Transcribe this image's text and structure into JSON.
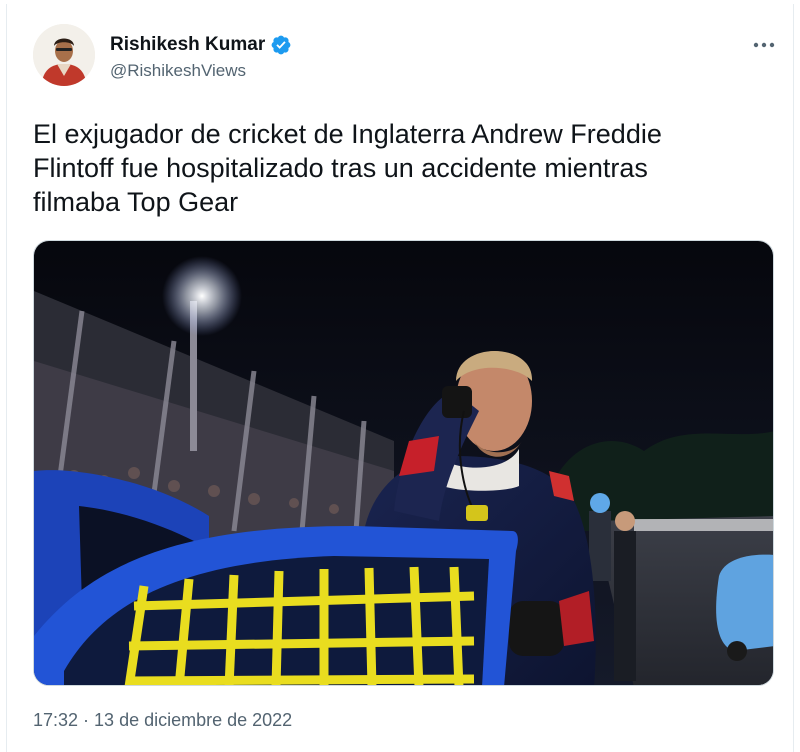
{
  "tweet": {
    "author": {
      "display_name": "Rishikesh Kumar",
      "handle": "@RishikeshViews",
      "verified": true,
      "avatar_icon": "person-photo"
    },
    "more_icon": "more-horizontal-icon",
    "text": "El exjugador de cricket de Inglaterra Andrew Freddie\nFlintoff fue hospitalizado tras un accidente mientras\nfilmaba Top Gear",
    "media": {
      "type": "photo",
      "icon": "photo-race-driver"
    },
    "timestamp": "17:32 · 13 de diciembre de 2022"
  },
  "colors": {
    "text_primary": "#0f1419",
    "text_secondary": "#536471",
    "verified_blue": "#1d9bf0",
    "border": "#cfd9de"
  }
}
